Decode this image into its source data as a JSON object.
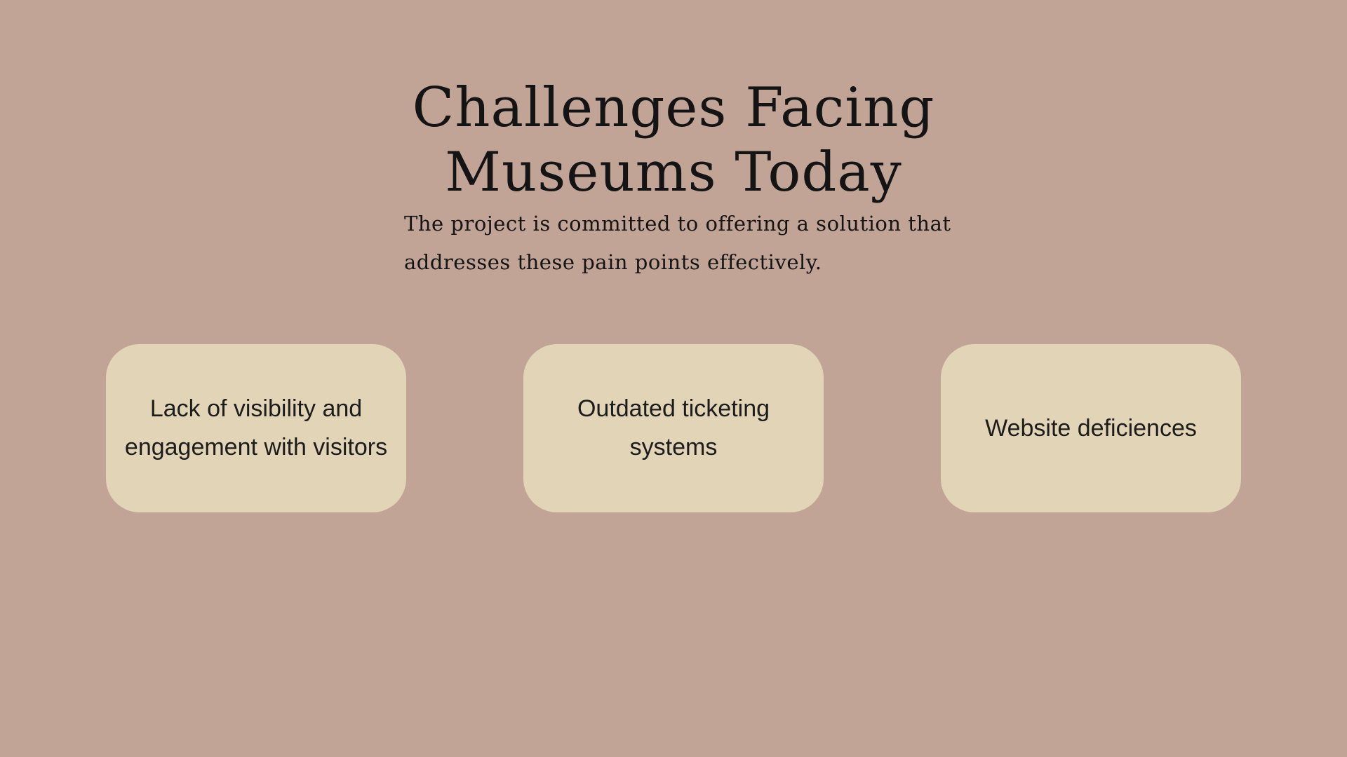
{
  "slide": {
    "title": "Challenges Facing Museums Today",
    "subtitle": "The project is committed to offering a solution that addresses these pain points effectively.",
    "background_color": "#c2a497",
    "card_color": "#e2d4b6",
    "cards": [
      {
        "label": "Lack of visibility and engagement with visitors"
      },
      {
        "label": "Outdated ticketing systems"
      },
      {
        "label": "Website deficiences"
      }
    ]
  }
}
